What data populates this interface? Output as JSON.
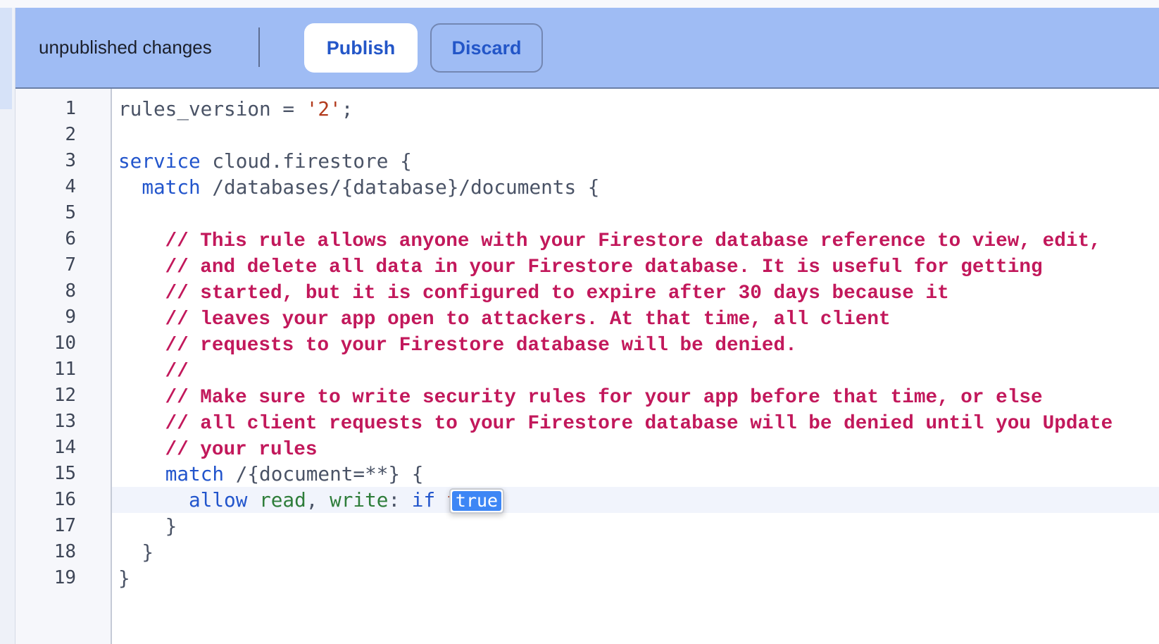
{
  "header": {
    "status": "unpublished changes",
    "publish_label": "Publish",
    "discard_label": "Discard"
  },
  "colors": {
    "header_bg": "#9fbcf4",
    "keyword": "#2255cc",
    "comment": "#c2185b",
    "string": "#b23a1c",
    "identifier": "#2e7d3a"
  },
  "editor": {
    "active_line": 16,
    "lines": [
      {
        "n": "1",
        "tokens": [
          {
            "t": "rules_version = ",
            "c": "pl"
          },
          {
            "t": "'2'",
            "c": "st"
          },
          {
            "t": ";",
            "c": "pl"
          }
        ]
      },
      {
        "n": "2",
        "tokens": []
      },
      {
        "n": "3",
        "tokens": [
          {
            "t": "service",
            "c": "kw"
          },
          {
            "t": " cloud.firestore {",
            "c": "pl"
          }
        ]
      },
      {
        "n": "4",
        "tokens": [
          {
            "t": "  ",
            "c": "pl"
          },
          {
            "t": "match",
            "c": "kw"
          },
          {
            "t": " /databases/{database}/documents {",
            "c": "pl"
          }
        ]
      },
      {
        "n": "5",
        "tokens": []
      },
      {
        "n": "6",
        "tokens": [
          {
            "t": "    // This rule allows anyone with your Firestore database reference to view, edit,",
            "c": "cm"
          }
        ]
      },
      {
        "n": "7",
        "tokens": [
          {
            "t": "    // and delete all data in your Firestore database. It is useful for getting",
            "c": "cm"
          }
        ]
      },
      {
        "n": "8",
        "tokens": [
          {
            "t": "    // started, but it is configured to expire after 30 days because it",
            "c": "cm"
          }
        ]
      },
      {
        "n": "9",
        "tokens": [
          {
            "t": "    // leaves your app open to attackers. At that time, all client",
            "c": "cm"
          }
        ]
      },
      {
        "n": "10",
        "tokens": [
          {
            "t": "    // requests to your Firestore database will be denied.",
            "c": "cm"
          }
        ]
      },
      {
        "n": "11",
        "tokens": [
          {
            "t": "    //",
            "c": "cm"
          }
        ]
      },
      {
        "n": "12",
        "tokens": [
          {
            "t": "    // Make sure to write security rules for your app before that time, or else",
            "c": "cm"
          }
        ]
      },
      {
        "n": "13",
        "tokens": [
          {
            "t": "    // all client requests to your Firestore database will be denied until you Update",
            "c": "cm"
          }
        ]
      },
      {
        "n": "14",
        "tokens": [
          {
            "t": "    // your rules",
            "c": "cm"
          }
        ]
      },
      {
        "n": "15",
        "tokens": [
          {
            "t": "    ",
            "c": "pl"
          },
          {
            "t": "match",
            "c": "kw"
          },
          {
            "t": " /{document=**} {",
            "c": "pl"
          }
        ]
      },
      {
        "n": "16",
        "tokens": [
          {
            "t": "      ",
            "c": "pl"
          },
          {
            "t": "allow",
            "c": "kw"
          },
          {
            "t": " ",
            "c": "pl"
          },
          {
            "t": "read",
            "c": "id"
          },
          {
            "t": ", ",
            "c": "pl"
          },
          {
            "t": "write",
            "c": "id"
          },
          {
            "t": ": ",
            "c": "pl"
          },
          {
            "t": "if",
            "c": "kw"
          },
          {
            "t": " ",
            "c": "pl"
          },
          {
            "t": "true",
            "c": "st"
          },
          {
            "t": ";",
            "c": "pl"
          }
        ]
      },
      {
        "n": "17",
        "tokens": [
          {
            "t": "    }",
            "c": "pl"
          }
        ]
      },
      {
        "n": "18",
        "tokens": [
          {
            "t": "  }",
            "c": "pl"
          }
        ]
      },
      {
        "n": "19",
        "tokens": [
          {
            "t": "}",
            "c": "pl"
          }
        ]
      }
    ]
  },
  "autocomplete": {
    "items": [
      "true"
    ]
  }
}
